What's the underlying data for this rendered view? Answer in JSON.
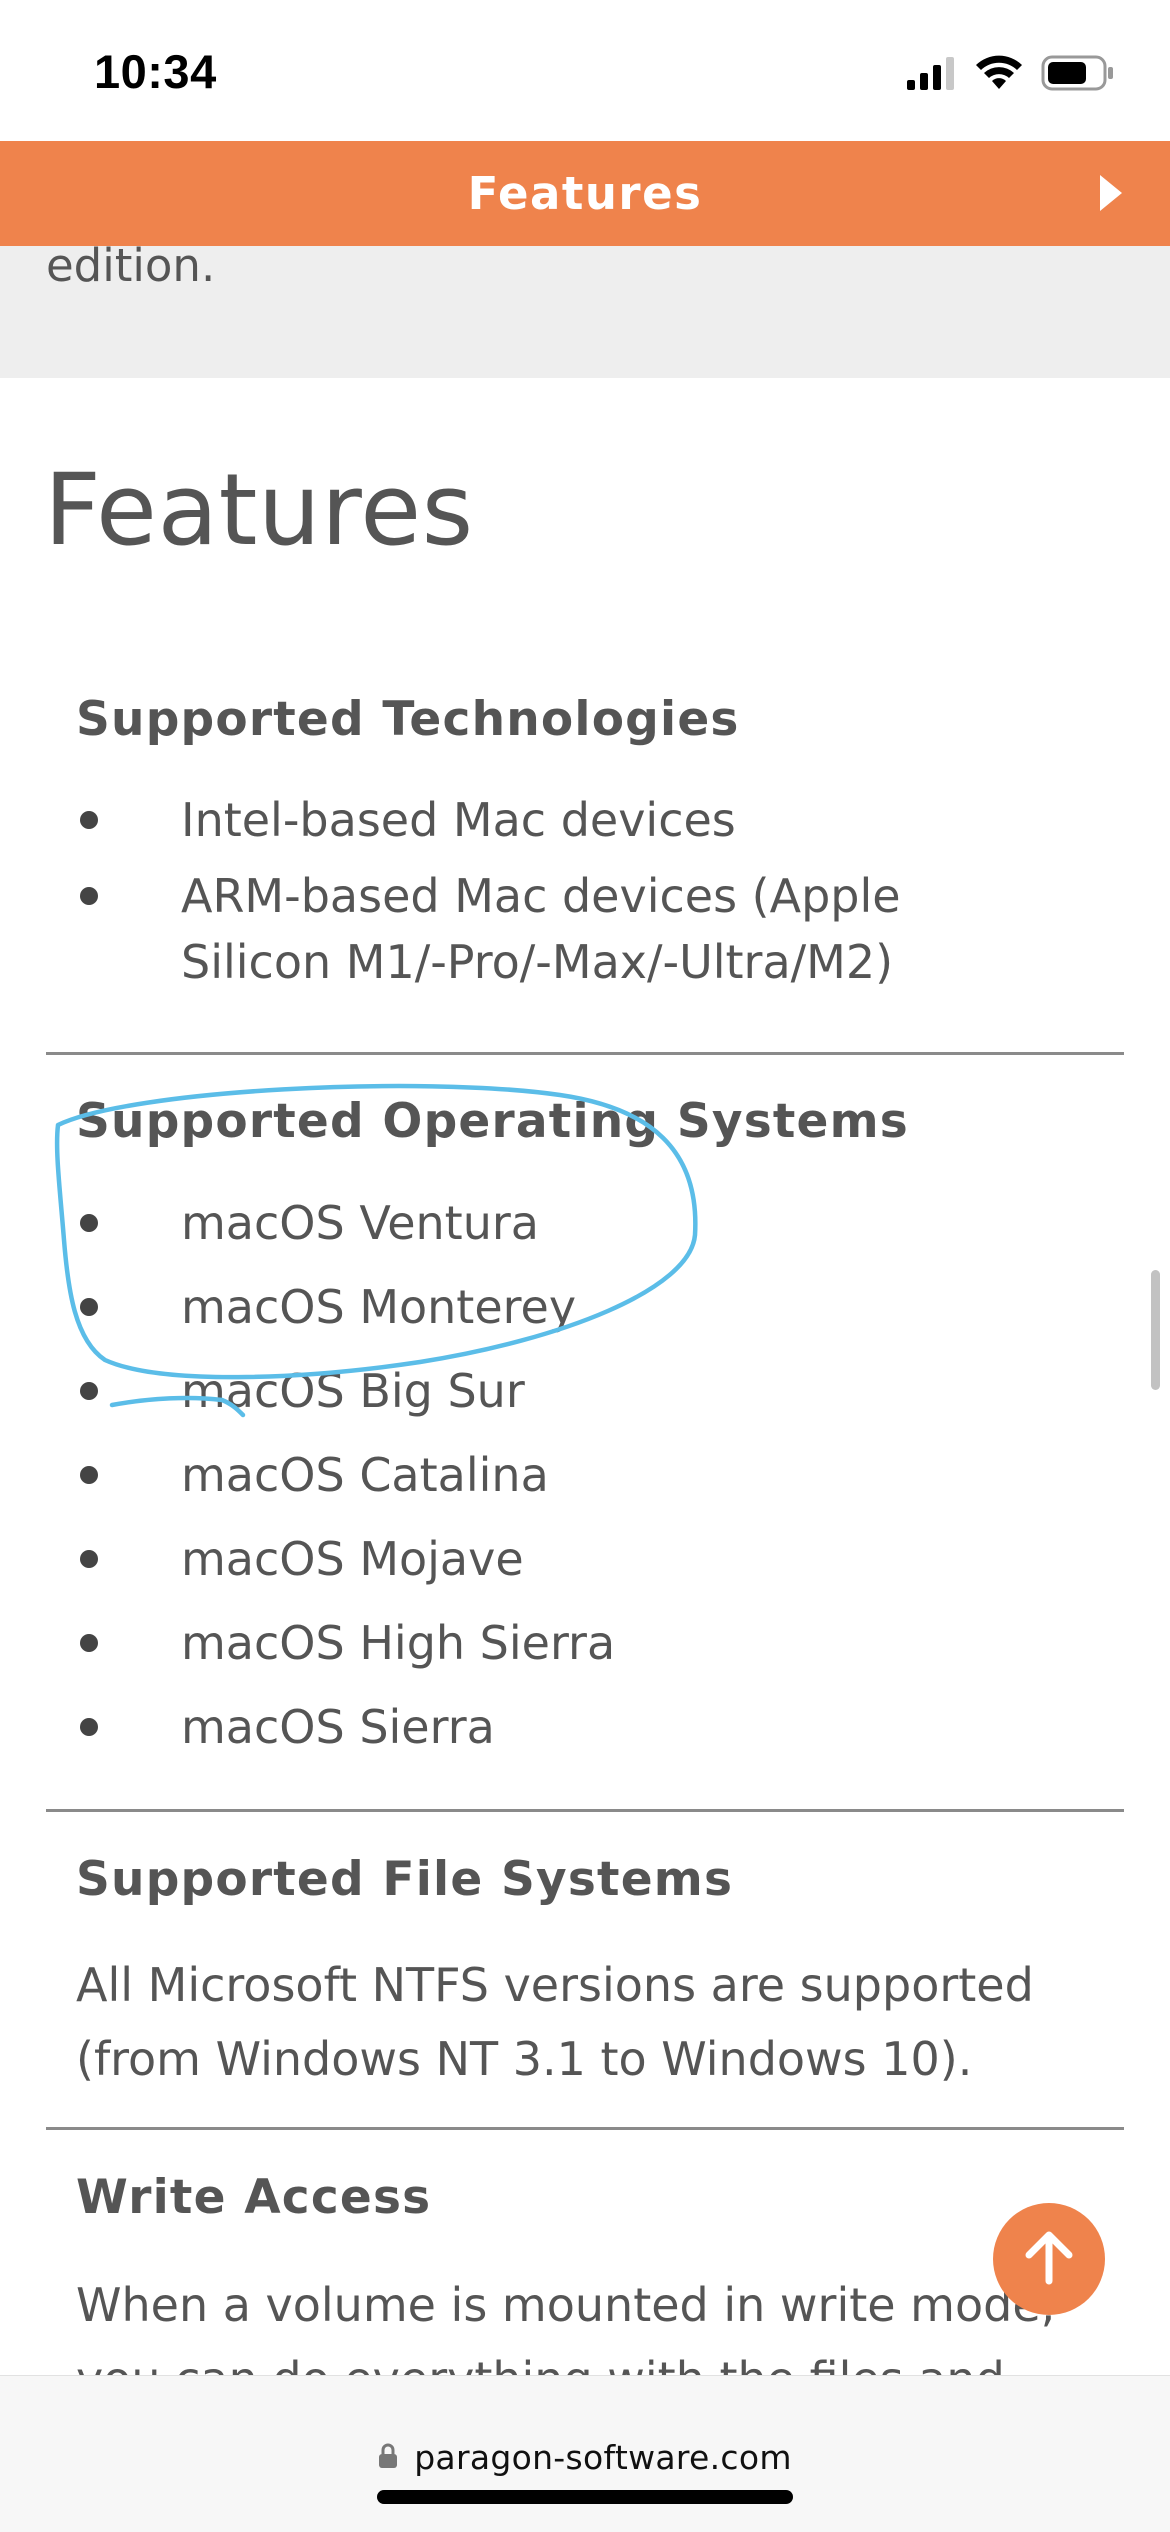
{
  "status_bar": {
    "time": "10:34"
  },
  "header": {
    "title": "Features"
  },
  "previous_section": {
    "tail_text": "edition."
  },
  "main": {
    "title": "Features",
    "sections": [
      {
        "heading": "Supported Technologies",
        "items": [
          "Intel-based Mac devices",
          "ARM-based Mac devices (Apple Silicon M1/-Pro/-Max/-Ultra/M2)"
        ]
      },
      {
        "heading": "Supported Operating Systems",
        "items": [
          "macOS Ventura",
          "macOS Monterey",
          "macOS Big Sur",
          "macOS Catalina",
          "macOS Mojave",
          "macOS High Sierra",
          "macOS Sierra"
        ]
      },
      {
        "heading": "Supported File Systems",
        "text": "All Microsoft NTFS versions are supported (from Windows NT 3.1 to Windows 10)."
      },
      {
        "heading": "Write Access",
        "text": "When a volume is mounted in write mode, you can do everything with the files and"
      }
    ]
  },
  "browser": {
    "url": "paragon-software.com"
  },
  "colors": {
    "accent": "#ef834c",
    "annotation": "#5bbde8",
    "text": "#555555"
  },
  "icons": {
    "header_arrow": "chevron-right-icon",
    "scroll_top": "arrow-up-icon",
    "url_lock": "lock-icon"
  }
}
